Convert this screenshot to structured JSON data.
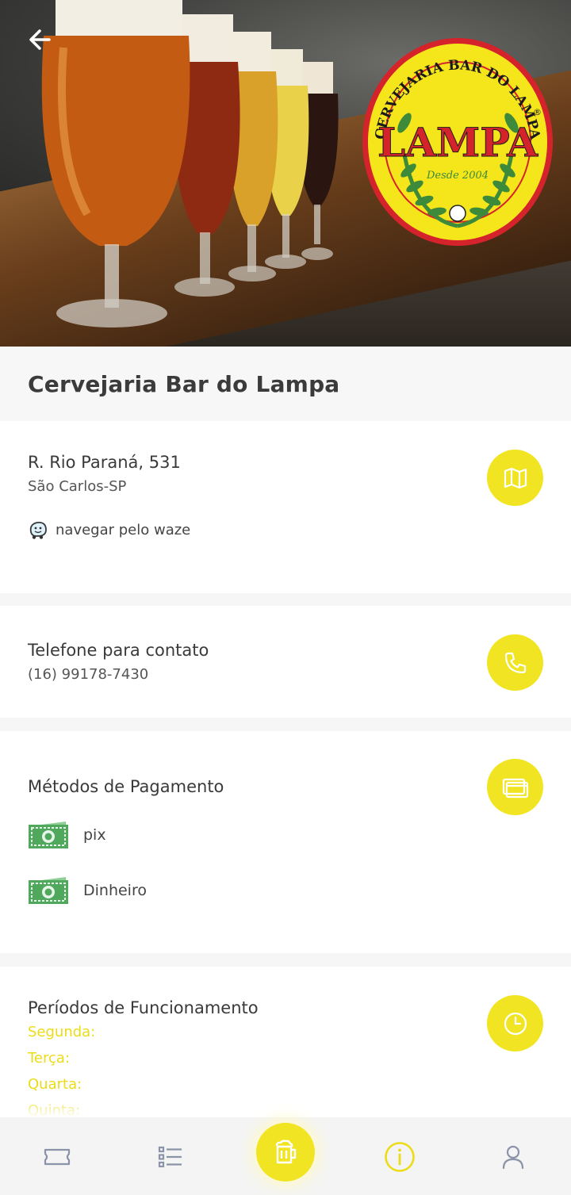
{
  "venue": {
    "name": "Cervejaria Bar do Lampa",
    "logo_text_top": "CERVEJARIA BAR DO LAMPA",
    "logo_text_main": "LAMPA",
    "logo_text_since": "Desde 2004"
  },
  "address": {
    "street": "R. Rio Paraná, 531",
    "city": "São Carlos-SP",
    "waze_label": "navegar pelo waze"
  },
  "contact": {
    "title": "Telefone para contato",
    "phone": "(16) 99178-7430"
  },
  "payment": {
    "title": "Métodos de Pagamento",
    "methods": [
      {
        "label": "pix",
        "icon": "cash-icon"
      },
      {
        "label": "Dinheiro",
        "icon": "cash-icon"
      }
    ]
  },
  "hours": {
    "title": "Períodos de Funcionamento",
    "days": [
      "Segunda:",
      "Terça:",
      "Quarta:",
      "Quinta:"
    ]
  },
  "nav": {
    "items": [
      {
        "icon": "ticket-icon"
      },
      {
        "icon": "list-icon"
      },
      {
        "icon": "beer-mug-icon"
      },
      {
        "icon": "info-icon",
        "active": true
      },
      {
        "icon": "user-icon"
      }
    ]
  },
  "colors": {
    "accent": "#f1e523",
    "day_text": "#ebdc18",
    "logo_red": "#d5232b",
    "logo_yellow": "#f5e51b",
    "logo_green": "#3c8a3a"
  }
}
